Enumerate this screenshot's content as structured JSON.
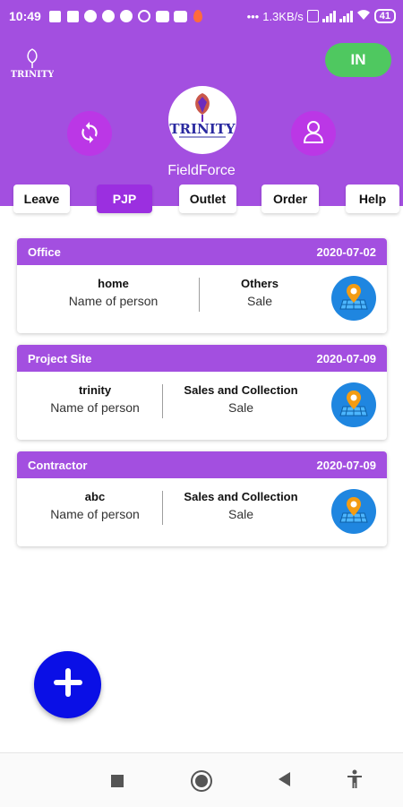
{
  "status_bar": {
    "time": "10:49",
    "network_speed": "1.3KB/s",
    "battery": "41",
    "dots": "•••"
  },
  "header": {
    "app_name": "FieldForce",
    "in_button": "IN",
    "logo_text": "TRINITY"
  },
  "tabs": [
    {
      "label": "Leave",
      "active": false
    },
    {
      "label": "PJP",
      "active": true
    },
    {
      "label": "Outlet",
      "active": false
    },
    {
      "label": "Order",
      "active": false
    },
    {
      "label": "Help",
      "active": false
    }
  ],
  "cards": [
    {
      "category": "Office",
      "date": "2020-07-02",
      "left_value": "home",
      "left_label": "Name of person",
      "right_value": "Others",
      "right_label": "Sale"
    },
    {
      "category": "Project Site",
      "date": "2020-07-09",
      "left_value": "trinity",
      "left_label": "Name of person",
      "right_value": "Sales and Collection",
      "right_label": "Sale"
    },
    {
      "category": "Contractor",
      "date": "2020-07-09",
      "left_value": "abc",
      "left_label": "Name of person",
      "right_value": "Sales and Collection",
      "right_label": "Sale"
    }
  ],
  "colors": {
    "primary": "#a34fe0",
    "active_tab": "#9b2fe0",
    "in_button": "#4fc860",
    "fab": "#0a0fe6",
    "map_button": "#1f86e0"
  },
  "icons": {
    "sync": "sync-icon",
    "profile": "user-profile-icon",
    "map": "map-location-icon",
    "add": "plus-icon"
  }
}
